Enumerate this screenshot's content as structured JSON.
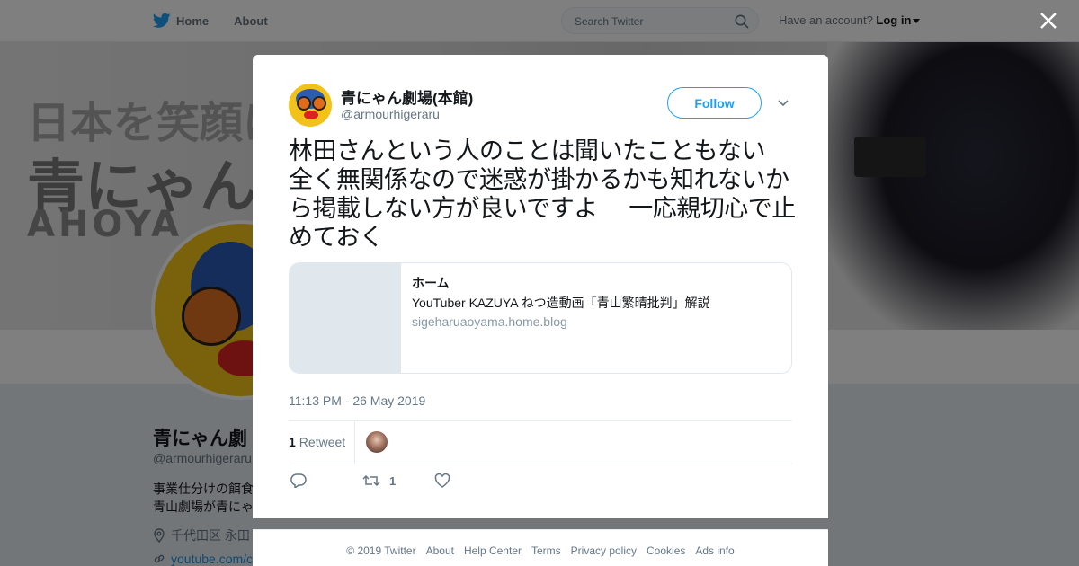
{
  "nav": {
    "home_label": "Home",
    "about_label": "About",
    "search_placeholder": "Search Twitter",
    "account_prompt": "Have an account?",
    "login_label": "Log in"
  },
  "background_profile": {
    "header_text": [
      "日本を笑顔に",
      "青にゃん",
      "AHOYA"
    ],
    "name": "青にゃん劇",
    "handle": "@armourhigeraru",
    "bio_lines": [
      "事業仕分けの餌食",
      "青山劇場が青にゃ"
    ],
    "location": "千代田区 永田",
    "url": "youtube.com/c"
  },
  "tweet": {
    "author_name": "青にゃん劇場(本館)",
    "author_handle": "@armourhigeraru",
    "follow_label": "Follow",
    "text": "林田さんという人のことは聞いたこともない　全く無関係なので迷惑が掛かるかも知れないから掲載しない方が良いですよ　 一応親切心で止めておく",
    "card": {
      "title": "ホーム",
      "description": "YouTuber KAZUYA ねつ造動画「青山繁晴批判」解説",
      "domain": "sigeharuaoyama.home.blog"
    },
    "timestamp": "11:13 PM - 26 May 2019",
    "retweet_count": "1",
    "retweet_label": "Retweet",
    "action_retweet_count": "1"
  },
  "footer": {
    "links": [
      "© 2019 Twitter",
      "About",
      "Help Center",
      "Terms",
      "Privacy policy",
      "Cookies",
      "Ads info"
    ]
  },
  "colors": {
    "accent": "#1da1f2",
    "text_primary": "#14171a",
    "text_secondary": "#657786",
    "overlay": "rgba(0,0,0,0.5)"
  },
  "icons": {
    "logo": "twitter-bird-icon",
    "search": "search-icon",
    "close": "close-icon",
    "reply": "reply-icon",
    "retweet": "retweet-icon",
    "like": "heart-icon"
  }
}
